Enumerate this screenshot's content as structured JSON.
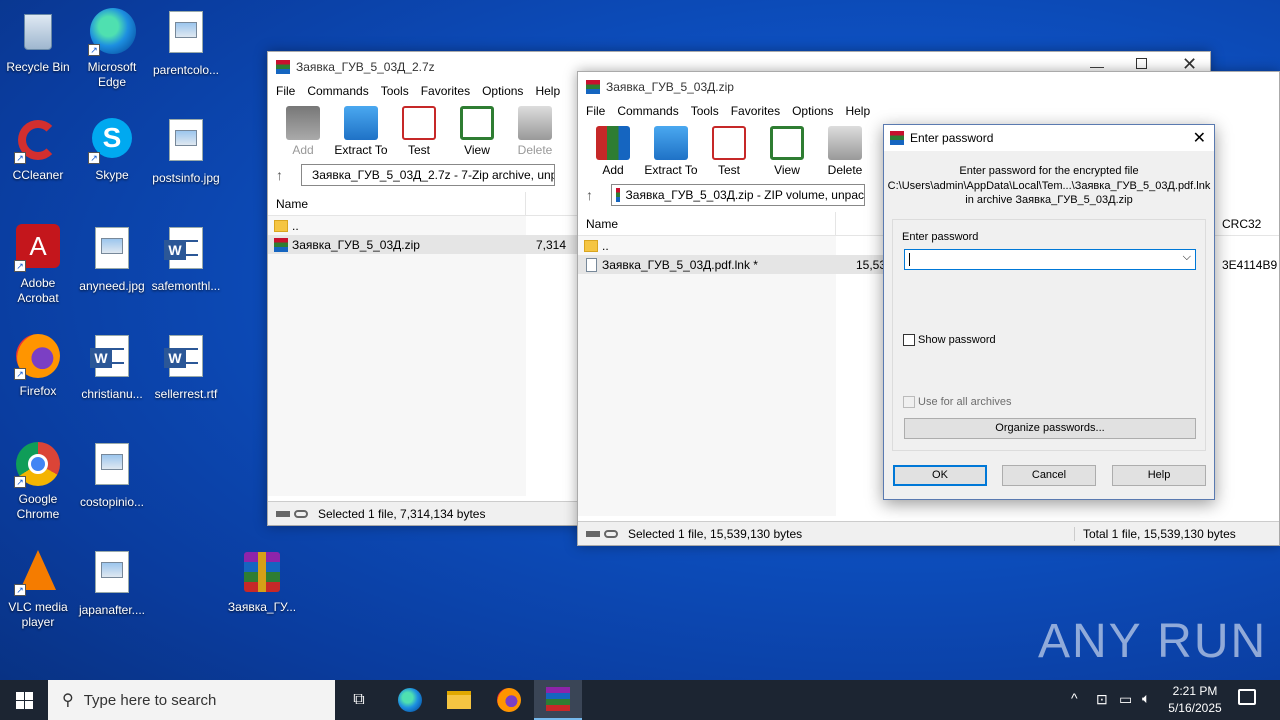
{
  "desktop": {
    "icons": [
      {
        "label": "Recycle Bin"
      },
      {
        "label": "Microsoft Edge"
      },
      {
        "label": "parentcolo..."
      },
      {
        "label": "CCleaner"
      },
      {
        "label": "Skype"
      },
      {
        "label": "postsinfo.jpg"
      },
      {
        "label": "Adobe Acrobat"
      },
      {
        "label": "anyneed.jpg"
      },
      {
        "label": "safemonthl..."
      },
      {
        "label": "Firefox"
      },
      {
        "label": "christianu..."
      },
      {
        "label": "sellerrest.rtf"
      },
      {
        "label": "Google Chrome"
      },
      {
        "label": "costopinio..."
      },
      {
        "label": "VLC media player"
      },
      {
        "label": "japanafter...."
      },
      {
        "label": "Заявка_ГУ..."
      }
    ]
  },
  "window1": {
    "title": "Заявка_ГУВ_5_03Д_2.7z",
    "menu": [
      "File",
      "Commands",
      "Tools",
      "Favorites",
      "Options",
      "Help"
    ],
    "tools": [
      "Add",
      "Extract To",
      "Test",
      "View",
      "Delete"
    ],
    "address": "Заявка_ГУВ_5_03Д_2.7z - 7-Zip archive, unp",
    "col_name": "Name",
    "rows": [
      {
        "name": "..",
        "size": ""
      },
      {
        "name": "Заявка_ГУВ_5_03Д.zip",
        "size": "7,314"
      }
    ],
    "status": "Selected 1 file, 7,314,134 bytes"
  },
  "window2": {
    "title": "Заявка_ГУВ_5_03Д.zip",
    "menu": [
      "File",
      "Commands",
      "Tools",
      "Favorites",
      "Options",
      "Help"
    ],
    "tools": [
      "Add",
      "Extract To",
      "Test",
      "View",
      "Delete"
    ],
    "address": "Заявка_ГУВ_5_03Д.zip - ZIP volume, unpac",
    "col_name": "Name",
    "col_crc": "CRC32",
    "rows": [
      {
        "name": "..",
        "size": "",
        "crc": ""
      },
      {
        "name": "Заявка_ГУВ_5_03Д.pdf.lnk *",
        "size": "15,53",
        "crc": "3E4114B9"
      }
    ],
    "status": "Selected 1 file, 15,539,130 bytes",
    "status_right": "Total 1 file, 15,539,130 bytes"
  },
  "dialog": {
    "title": "Enter password",
    "line1": "Enter password for the encrypted file",
    "line2": "C:\\Users\\admin\\AppData\\Local\\Tem...\\Заявка_ГУВ_5_03Д.pdf.lnk",
    "line3": "in archive Заявка_ГУВ_5_03Д.zip",
    "field_label": "Enter password",
    "field_value": "",
    "show_password": "Show password",
    "use_all": "Use for all archives",
    "organize": "Organize passwords...",
    "ok": "OK",
    "cancel": "Cancel",
    "help": "Help"
  },
  "taskbar": {
    "search_placeholder": "Type here to search",
    "time": "2:21 PM",
    "date": "5/16/2025"
  },
  "watermark": "ANY RUN"
}
